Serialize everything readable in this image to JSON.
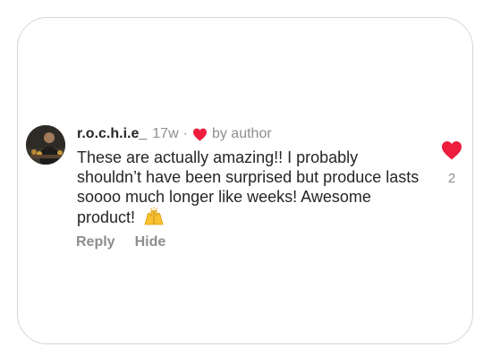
{
  "comment": {
    "username": "r.o.c.h.i.e_",
    "time": "17w",
    "separator": "·",
    "liked_by": "by author",
    "text": "These are actually amazing!! I probably shouldn’t have been surprised but produce lasts soooo much longer like weeks! Awesome product!",
    "emoji_icon": "raising-hands-icon",
    "like_count": "2"
  },
  "actions": {
    "reply": "Reply",
    "hide": "Hide"
  },
  "colors": {
    "heart": "#ee1d3e",
    "muted": "#8e8e8e",
    "text": "#262626"
  }
}
